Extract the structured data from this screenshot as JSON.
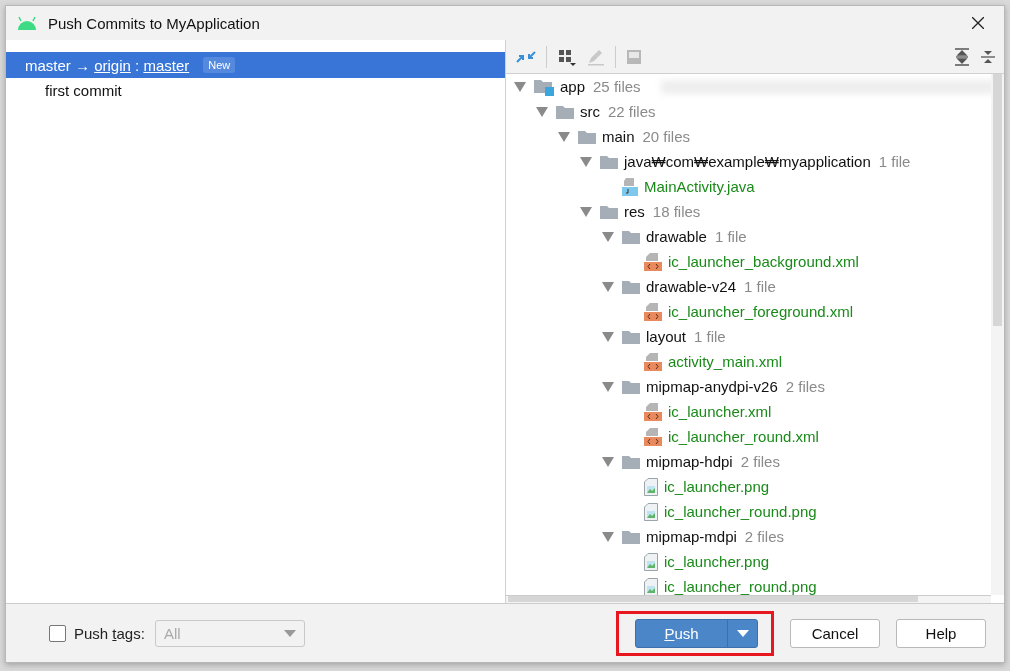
{
  "window": {
    "title": "Push Commits to MyApplication"
  },
  "commits": {
    "branch": {
      "source": "master",
      "arrow": "→",
      "remote": "origin",
      "separator": ":",
      "target": "master",
      "badge": "New",
      "selected": true
    },
    "items": [
      {
        "message": "first commit",
        "selected": false
      }
    ]
  },
  "tree": [
    {
      "name": "app",
      "count": "25 files",
      "kind": "module",
      "expanded": true,
      "children": [
        {
          "name": "src",
          "count": "22 files",
          "kind": "folder",
          "expanded": true,
          "children": [
            {
              "name": "main",
              "count": "20 files",
              "kind": "folder",
              "expanded": true,
              "children": [
                {
                  "name": "java₩com₩example₩myapplication",
                  "count": "1 file",
                  "kind": "folder",
                  "expanded": true,
                  "children": [
                    {
                      "name": "MainActivity.java",
                      "kind": "java"
                    }
                  ]
                },
                {
                  "name": "res",
                  "count": "18 files",
                  "kind": "folder",
                  "expanded": true,
                  "children": [
                    {
                      "name": "drawable",
                      "count": "1 file",
                      "kind": "folder",
                      "expanded": true,
                      "children": [
                        {
                          "name": "ic_launcher_background.xml",
                          "kind": "xml"
                        }
                      ]
                    },
                    {
                      "name": "drawable-v24",
                      "count": "1 file",
                      "kind": "folder",
                      "expanded": true,
                      "children": [
                        {
                          "name": "ic_launcher_foreground.xml",
                          "kind": "xml"
                        }
                      ]
                    },
                    {
                      "name": "layout",
                      "count": "1 file",
                      "kind": "folder",
                      "expanded": true,
                      "children": [
                        {
                          "name": "activity_main.xml",
                          "kind": "xml"
                        }
                      ]
                    },
                    {
                      "name": "mipmap-anydpi-v26",
                      "count": "2 files",
                      "kind": "folder",
                      "expanded": true,
                      "children": [
                        {
                          "name": "ic_launcher.xml",
                          "kind": "xml"
                        },
                        {
                          "name": "ic_launcher_round.xml",
                          "kind": "xml"
                        }
                      ]
                    },
                    {
                      "name": "mipmap-hdpi",
                      "count": "2 files",
                      "kind": "folder",
                      "expanded": true,
                      "children": [
                        {
                          "name": "ic_launcher.png",
                          "kind": "png"
                        },
                        {
                          "name": "ic_launcher_round.png",
                          "kind": "png"
                        }
                      ]
                    },
                    {
                      "name": "mipmap-mdpi",
                      "count": "2 files",
                      "kind": "folder",
                      "expanded": true,
                      "children": [
                        {
                          "name": "ic_launcher.png",
                          "kind": "png"
                        },
                        {
                          "name": "ic_launcher_round.png",
                          "kind": "png"
                        }
                      ]
                    }
                  ]
                }
              ]
            }
          ]
        }
      ]
    }
  ],
  "push_tags": {
    "before": "Push ",
    "mnemonic": "t",
    "after": "ags:",
    "checked": false,
    "dropdown": "All",
    "disabled": true
  },
  "buttons": [
    {
      "kind": "primary",
      "mnemonic": "P",
      "rest": "ush"
    },
    {
      "kind": "plain",
      "label": "Cancel"
    },
    {
      "kind": "plain",
      "label": "Help"
    }
  ]
}
